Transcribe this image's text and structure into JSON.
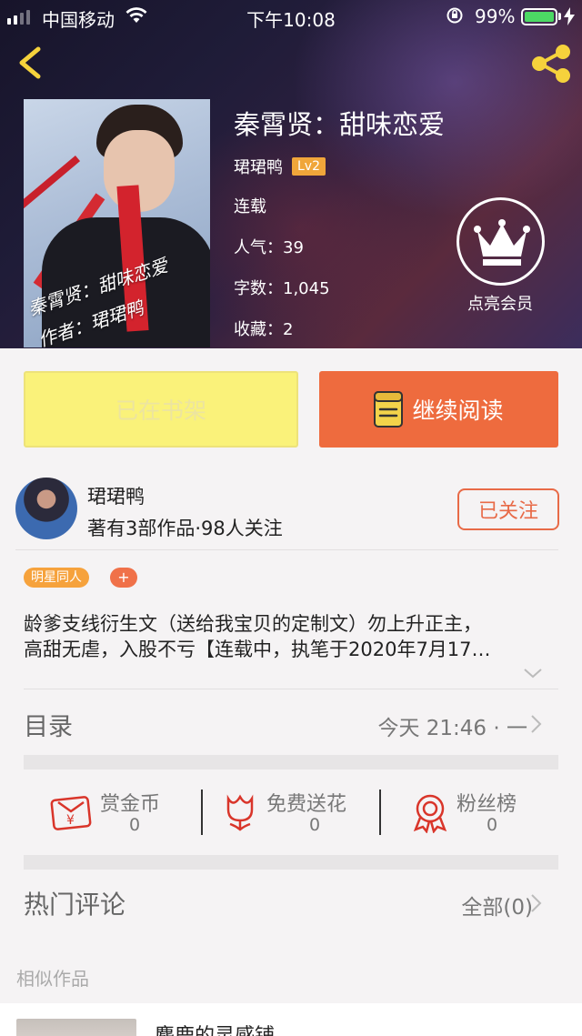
{
  "status_bar": {
    "carrier": "中国移动",
    "time": "下午10:08",
    "battery": "99%"
  },
  "book": {
    "title": "秦霄贤：甜味恋爱",
    "author": "珺珺鸭",
    "level": "Lv2",
    "status": "连载",
    "popularity": "人气：39",
    "word_count": "字数：1,045",
    "favorites": "收藏：2",
    "cover_text_line1": "秦霄贤：甜味恋爱",
    "cover_text_line2": "作者：珺珺鸭"
  },
  "vip_label": "点亮会员",
  "actions": {
    "shelf_label": "已在书架",
    "read_label": "继续阅读"
  },
  "author_card": {
    "name": "珺珺鸭",
    "stats": "著有3部作品·98人关注",
    "follow_label": "已关注"
  },
  "tags": [
    "明星同人"
  ],
  "tag_add": "+",
  "intro": {
    "line1": "龄爹支线衍生文（送给我宝贝的定制文）勿上升正主，",
    "line2": "高甜无虐，入股不亏【连载中，执笔于2020年7月17…"
  },
  "catalog": {
    "label": "目录",
    "update": "今天 21:46 · 一"
  },
  "stats": [
    {
      "label": "赏金币",
      "value": "0"
    },
    {
      "label": "免费送花",
      "value": "0"
    },
    {
      "label": "粉丝榜",
      "value": "0"
    }
  ],
  "comments": {
    "label": "热门评论",
    "all": "全部(0)"
  },
  "similar": {
    "label": "相似作品",
    "first_title": "麋鹿的灵感铺"
  },
  "colors": {
    "accent_orange": "#ee6b3e",
    "shelf_yellow": "#faf27a",
    "nav_yellow": "#f5d23c",
    "stat_red": "#d9352a"
  },
  "icons": [
    "back-arrow-icon",
    "share-icon",
    "crown-icon",
    "book-icon",
    "chevron-right-icon",
    "chevron-down-icon",
    "coin-bag-icon",
    "flower-icon",
    "medal-icon"
  ]
}
